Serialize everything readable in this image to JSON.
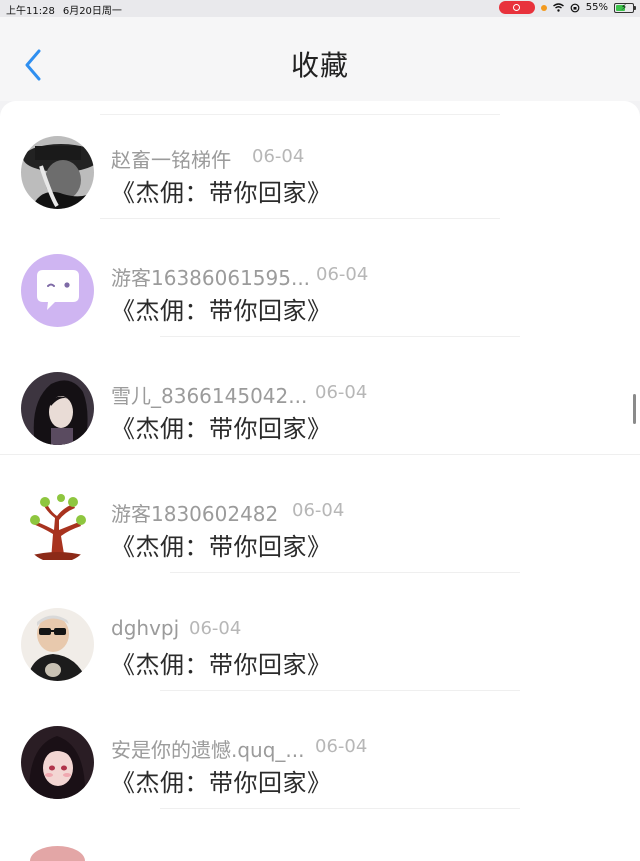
{
  "status_bar": {
    "time": "上午11:28",
    "date": "6月20日周一",
    "battery": "55%",
    "battery_level": 0.55
  },
  "header": {
    "title": "收藏"
  },
  "favorites": [
    {
      "username": "赵畜一铭梯仵",
      "date": "06-04",
      "title": "《杰佣：带你回家》",
      "avatar_icon": "dark-hat-portrait"
    },
    {
      "username": "游客16386061595...",
      "date": "06-04",
      "title": "《杰佣：带你回家》",
      "avatar_icon": "chat-bubble-face"
    },
    {
      "username": "雪儿_8366145042...",
      "date": "06-04",
      "title": "《杰佣：带你回家》",
      "avatar_icon": "long-hair-portrait"
    },
    {
      "username": "游客1830602482",
      "date": "06-04",
      "title": "《杰佣：带你回家》",
      "avatar_icon": "tree-icon"
    },
    {
      "username": "dghvpj",
      "date": "06-04",
      "title": "《杰佣：带你回家》",
      "avatar_icon": "sunglasses-portrait"
    },
    {
      "username": "安是你的遗憾.quq_...",
      "date": "06-04",
      "title": "《杰佣：带你回家》",
      "avatar_icon": "anime-girl-portrait"
    }
  ],
  "colors": {
    "accent": "#2f8ff0",
    "username": "#9b9b9b",
    "date": "#b7b7b7",
    "title": "#2b2b2b"
  }
}
